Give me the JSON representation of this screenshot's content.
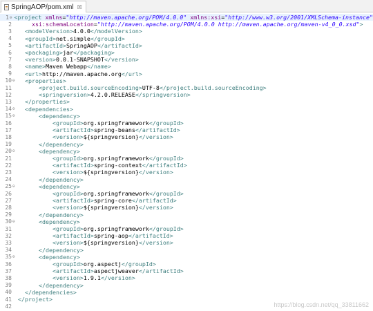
{
  "tab": {
    "title": "SpringAOP/pom.xml",
    "close": "☒"
  },
  "watermark": "https://blog.csdn.net/qq_33811662",
  "lines": [
    {
      "n": "1",
      "fold": "⊖",
      "segs": [
        [
          "t",
          "<"
        ],
        [
          "t",
          "project "
        ],
        [
          "a",
          "xmlns"
        ],
        [
          "txt",
          "="
        ],
        [
          "v",
          "\"http://maven.apache.org/POM/4.0.0\""
        ],
        [
          "txt",
          " "
        ],
        [
          "a",
          "xmlns:xsi"
        ],
        [
          "txt",
          "="
        ],
        [
          "v",
          "\"http://www.w3.org/2001/XMLSchema-instance\""
        ]
      ]
    },
    {
      "n": "2",
      "fold": "",
      "segs": [
        [
          "txt",
          "    "
        ],
        [
          "a",
          "xsi:schemaLocation"
        ],
        [
          "txt",
          "="
        ],
        [
          "v",
          "\"http://maven.apache.org/POM/4.0.0 http://maven.apache.org/maven-v4_0_0.xsd\""
        ],
        [
          "t",
          ">"
        ]
      ]
    },
    {
      "n": "3",
      "fold": "",
      "segs": [
        [
          "txt",
          "  "
        ],
        [
          "t",
          "<modelVersion>"
        ],
        [
          "txt",
          "4.0.0"
        ],
        [
          "t",
          "</modelVersion>"
        ]
      ]
    },
    {
      "n": "4",
      "fold": "",
      "segs": [
        [
          "txt",
          "  "
        ],
        [
          "t",
          "<groupId>"
        ],
        [
          "txt",
          "net.simple"
        ],
        [
          "t",
          "</groupId>"
        ]
      ]
    },
    {
      "n": "5",
      "fold": "",
      "segs": [
        [
          "txt",
          "  "
        ],
        [
          "t",
          "<artifactId>"
        ],
        [
          "txt",
          "SpringAOP"
        ],
        [
          "t",
          "</artifactId>"
        ]
      ]
    },
    {
      "n": "6",
      "fold": "",
      "segs": [
        [
          "txt",
          "  "
        ],
        [
          "t",
          "<packaging>"
        ],
        [
          "txt",
          "jar"
        ],
        [
          "t",
          "</packaging>"
        ]
      ]
    },
    {
      "n": "7",
      "fold": "",
      "segs": [
        [
          "txt",
          "  "
        ],
        [
          "t",
          "<version>"
        ],
        [
          "txt",
          "0.0.1-SNAPSHOT"
        ],
        [
          "t",
          "</version>"
        ]
      ]
    },
    {
      "n": "8",
      "fold": "",
      "segs": [
        [
          "txt",
          "  "
        ],
        [
          "t",
          "<name>"
        ],
        [
          "txt",
          "Maven Webapp"
        ],
        [
          "t",
          "</name>"
        ]
      ]
    },
    {
      "n": "9",
      "fold": "",
      "segs": [
        [
          "txt",
          "  "
        ],
        [
          "t",
          "<url>"
        ],
        [
          "txt",
          "http://maven.apache.org"
        ],
        [
          "t",
          "</url>"
        ]
      ]
    },
    {
      "n": "10",
      "fold": "⊖",
      "segs": [
        [
          "txt",
          "  "
        ],
        [
          "t",
          "<properties>"
        ]
      ]
    },
    {
      "n": "11",
      "fold": "",
      "segs": [
        [
          "txt",
          "      "
        ],
        [
          "t",
          "<project.build.sourceEncoding>"
        ],
        [
          "txt",
          "UTF-8"
        ],
        [
          "t",
          "</project.build.sourceEncoding>"
        ]
      ]
    },
    {
      "n": "12",
      "fold": "",
      "segs": [
        [
          "txt",
          "      "
        ],
        [
          "t",
          "<springversion>"
        ],
        [
          "txt",
          "4.2.0.RELEASE"
        ],
        [
          "t",
          "</springversion>"
        ]
      ]
    },
    {
      "n": "13",
      "fold": "",
      "segs": [
        [
          "txt",
          "  "
        ],
        [
          "t",
          "</properties>"
        ]
      ]
    },
    {
      "n": "14",
      "fold": "⊖",
      "segs": [
        [
          "txt",
          "  "
        ],
        [
          "t",
          "<dependencies>"
        ]
      ]
    },
    {
      "n": "15",
      "fold": "⊖",
      "segs": [
        [
          "txt",
          "      "
        ],
        [
          "t",
          "<dependency>"
        ]
      ]
    },
    {
      "n": "16",
      "fold": "",
      "segs": [
        [
          "txt",
          "          "
        ],
        [
          "t",
          "<groupId>"
        ],
        [
          "txt",
          "org.springframework"
        ],
        [
          "t",
          "</groupId>"
        ]
      ]
    },
    {
      "n": "17",
      "fold": "",
      "segs": [
        [
          "txt",
          "          "
        ],
        [
          "t",
          "<artifactId>"
        ],
        [
          "txt",
          "spring-beans"
        ],
        [
          "t",
          "</artifactId>"
        ]
      ]
    },
    {
      "n": "18",
      "fold": "",
      "segs": [
        [
          "txt",
          "          "
        ],
        [
          "t",
          "<version>"
        ],
        [
          "txt",
          "${springversion}"
        ],
        [
          "t",
          "</version>"
        ]
      ]
    },
    {
      "n": "19",
      "fold": "",
      "segs": [
        [
          "txt",
          "      "
        ],
        [
          "t",
          "</dependency>"
        ]
      ]
    },
    {
      "n": "20",
      "fold": "⊖",
      "segs": [
        [
          "txt",
          "      "
        ],
        [
          "t",
          "<dependency>"
        ]
      ]
    },
    {
      "n": "21",
      "fold": "",
      "segs": [
        [
          "txt",
          "          "
        ],
        [
          "t",
          "<groupId>"
        ],
        [
          "txt",
          "org.springframework"
        ],
        [
          "t",
          "</groupId>"
        ]
      ]
    },
    {
      "n": "22",
      "fold": "",
      "segs": [
        [
          "txt",
          "          "
        ],
        [
          "t",
          "<artifactId>"
        ],
        [
          "txt",
          "spring-context"
        ],
        [
          "t",
          "</artifactId>"
        ]
      ]
    },
    {
      "n": "23",
      "fold": "",
      "segs": [
        [
          "txt",
          "          "
        ],
        [
          "t",
          "<version>"
        ],
        [
          "txt",
          "${springversion}"
        ],
        [
          "t",
          "</version>"
        ]
      ]
    },
    {
      "n": "24",
      "fold": "",
      "segs": [
        [
          "txt",
          "      "
        ],
        [
          "t",
          "</dependency>"
        ]
      ]
    },
    {
      "n": "25",
      "fold": "⊖",
      "segs": [
        [
          "txt",
          "      "
        ],
        [
          "t",
          "<dependency>"
        ]
      ]
    },
    {
      "n": "26",
      "fold": "",
      "segs": [
        [
          "txt",
          "          "
        ],
        [
          "t",
          "<groupId>"
        ],
        [
          "txt",
          "org.springframework"
        ],
        [
          "t",
          "</groupId>"
        ]
      ]
    },
    {
      "n": "27",
      "fold": "",
      "segs": [
        [
          "txt",
          "          "
        ],
        [
          "t",
          "<artifactId>"
        ],
        [
          "txt",
          "spring-core"
        ],
        [
          "t",
          "</artifactId>"
        ]
      ]
    },
    {
      "n": "28",
      "fold": "",
      "segs": [
        [
          "txt",
          "          "
        ],
        [
          "t",
          "<version>"
        ],
        [
          "txt",
          "${springversion}"
        ],
        [
          "t",
          "</version>"
        ]
      ]
    },
    {
      "n": "29",
      "fold": "",
      "segs": [
        [
          "txt",
          "      "
        ],
        [
          "t",
          "</dependency>"
        ]
      ]
    },
    {
      "n": "30",
      "fold": "⊖",
      "segs": [
        [
          "txt",
          "      "
        ],
        [
          "t",
          "<dependency>"
        ]
      ]
    },
    {
      "n": "31",
      "fold": "",
      "segs": [
        [
          "txt",
          "          "
        ],
        [
          "t",
          "<groupId>"
        ],
        [
          "txt",
          "org.springframework"
        ],
        [
          "t",
          "</groupId>"
        ]
      ]
    },
    {
      "n": "32",
      "fold": "",
      "segs": [
        [
          "txt",
          "          "
        ],
        [
          "t",
          "<artifactId>"
        ],
        [
          "txt",
          "spring-aop"
        ],
        [
          "t",
          "</artifactId>"
        ]
      ]
    },
    {
      "n": "33",
      "fold": "",
      "segs": [
        [
          "txt",
          "          "
        ],
        [
          "t",
          "<version>"
        ],
        [
          "txt",
          "${springversion}"
        ],
        [
          "t",
          "</version>"
        ]
      ]
    },
    {
      "n": "34",
      "fold": "",
      "segs": [
        [
          "txt",
          "      "
        ],
        [
          "t",
          "</dependency>"
        ]
      ]
    },
    {
      "n": "35",
      "fold": "⊖",
      "segs": [
        [
          "txt",
          "      "
        ],
        [
          "t",
          "<dependency>"
        ]
      ]
    },
    {
      "n": "36",
      "fold": "",
      "segs": [
        [
          "txt",
          "          "
        ],
        [
          "t",
          "<groupId>"
        ],
        [
          "txt",
          "org.aspectj"
        ],
        [
          "t",
          "</groupId>"
        ]
      ]
    },
    {
      "n": "37",
      "fold": "",
      "segs": [
        [
          "txt",
          "          "
        ],
        [
          "t",
          "<artifactId>"
        ],
        [
          "txt",
          "aspectjweaver"
        ],
        [
          "t",
          "</artifactId>"
        ]
      ]
    },
    {
      "n": "38",
      "fold": "",
      "segs": [
        [
          "txt",
          "          "
        ],
        [
          "t",
          "<version>"
        ],
        [
          "txt",
          "1.9.1"
        ],
        [
          "t",
          "</version>"
        ]
      ]
    },
    {
      "n": "39",
      "fold": "",
      "segs": [
        [
          "txt",
          "      "
        ],
        [
          "t",
          "</dependency>"
        ]
      ]
    },
    {
      "n": "40",
      "fold": "",
      "segs": [
        [
          "txt",
          "  "
        ],
        [
          "t",
          "</dependencies>"
        ]
      ]
    },
    {
      "n": "41",
      "fold": "",
      "segs": [
        [
          "t",
          "</project>"
        ]
      ]
    },
    {
      "n": "42",
      "fold": "",
      "segs": []
    }
  ]
}
